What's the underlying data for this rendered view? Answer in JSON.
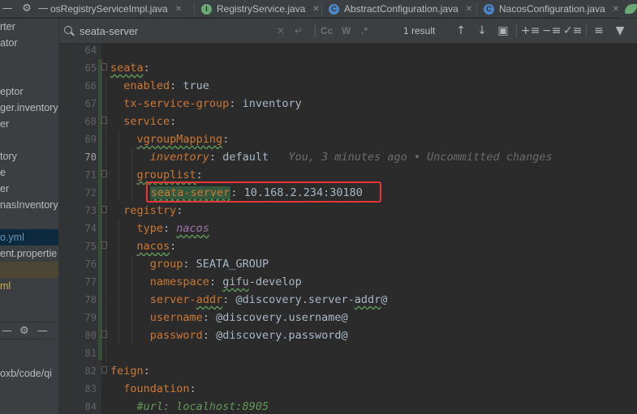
{
  "tabs": [
    {
      "label": "osRegistryServiceImpl.java",
      "icon_letter": "",
      "icon_color": "#c07a34"
    },
    {
      "label": "RegistryService.java",
      "icon_letter": "I",
      "icon_color": "#6aab73"
    },
    {
      "label": "AbstractConfiguration.java",
      "icon_letter": "C",
      "icon_color": "#4a86c8"
    },
    {
      "label": "NacosConfiguration.java",
      "icon_letter": "C",
      "icon_color": "#4a86c8"
    }
  ],
  "project_tree": [
    {
      "label": "rter",
      "style": ""
    },
    {
      "label": "ator",
      "style": ""
    },
    {
      "label": "",
      "style": ""
    },
    {
      "label": "",
      "style": ""
    },
    {
      "label": "eptor",
      "style": ""
    },
    {
      "label": "ger.inventory",
      "style": ""
    },
    {
      "label": "er",
      "style": ""
    },
    {
      "label": "",
      "style": ""
    },
    {
      "label": "tory",
      "style": ""
    },
    {
      "label": "e",
      "style": ""
    },
    {
      "label": "er",
      "style": ""
    },
    {
      "label": "nasInventory",
      "style": ""
    },
    {
      "label": "",
      "style": ""
    },
    {
      "label": "o.yml",
      "style": "sel blue"
    },
    {
      "label": "ent.propertie",
      "style": ""
    },
    {
      "label": "",
      "style": "hl"
    },
    {
      "label": "ml",
      "style": "yellow"
    }
  ],
  "project_path": "oxb/code/qi",
  "search": {
    "query": "seata-server",
    "results": "1 result",
    "match_case_label": "Cc",
    "words_label": "W",
    "regex_label": ".*"
  },
  "editor": {
    "blame": "You, 3 minutes ago • Uncommitted changes",
    "lines": [
      {
        "num": "64",
        "parts": []
      },
      {
        "num": "65",
        "parts": [
          {
            "t": "seata",
            "c": "ks"
          },
          {
            "t": ":",
            "c": "v"
          }
        ]
      },
      {
        "num": "66",
        "parts": [
          {
            "t": "  "
          },
          {
            "t": "enabled",
            "c": "k"
          },
          {
            "t": ": true",
            "c": "v"
          }
        ]
      },
      {
        "num": "67",
        "parts": [
          {
            "t": "  "
          },
          {
            "t": "tx-service-group",
            "c": "k"
          },
          {
            "t": ": inventory",
            "c": "v"
          }
        ]
      },
      {
        "num": "68",
        "parts": [
          {
            "t": "  "
          },
          {
            "t": "service",
            "c": "k"
          },
          {
            "t": ":",
            "c": "v"
          }
        ]
      },
      {
        "num": "69",
        "parts": [
          {
            "t": "    "
          },
          {
            "t": "vgroupMapping",
            "c": "ks"
          },
          {
            "t": ":",
            "c": "v"
          }
        ]
      },
      {
        "num": "70",
        "cur": true,
        "parts": [
          {
            "t": "      "
          },
          {
            "t": "inventory",
            "c": "ki"
          },
          {
            "t": ": default",
            "c": "v"
          },
          {
            "t": "   "
          },
          {
            "t": "You, 3 minutes ago • Uncommitted changes",
            "c": "blame"
          }
        ]
      },
      {
        "num": "71",
        "parts": [
          {
            "t": "    "
          },
          {
            "t": "grouplist",
            "c": "ks"
          },
          {
            "t": ":",
            "c": "v"
          }
        ]
      },
      {
        "num": "72",
        "parts": [
          {
            "t": "      "
          },
          {
            "t": "seata-server",
            "c": "found"
          },
          {
            "t": ": 10.168.2.234:30180",
            "c": "v"
          }
        ]
      },
      {
        "num": "73",
        "parts": [
          {
            "t": "  "
          },
          {
            "t": "registry",
            "c": "k"
          },
          {
            "t": ":",
            "c": "v"
          }
        ]
      },
      {
        "num": "74",
        "parts": [
          {
            "t": "    "
          },
          {
            "t": "type",
            "c": "k"
          },
          {
            "t": ": ",
            "c": "v"
          },
          {
            "t": "nacos",
            "c": "vi"
          }
        ]
      },
      {
        "num": "75",
        "parts": [
          {
            "t": "    "
          },
          {
            "t": "nacos",
            "c": "ks"
          },
          {
            "t": ":",
            "c": "v"
          }
        ]
      },
      {
        "num": "76",
        "parts": [
          {
            "t": "      "
          },
          {
            "t": "group",
            "c": "k"
          },
          {
            "t": ": SEATA_GROUP",
            "c": "v"
          }
        ]
      },
      {
        "num": "77",
        "parts": [
          {
            "t": "      "
          },
          {
            "t": "namespace",
            "c": "k"
          },
          {
            "t": ": ",
            "c": "v"
          },
          {
            "t": "gifu",
            "c": "vs"
          },
          {
            "t": "-develop",
            "c": "v"
          }
        ]
      },
      {
        "num": "78",
        "parts": [
          {
            "t": "      "
          },
          {
            "t": "server-",
            "c": "k"
          },
          {
            "t": "addr",
            "c": "ks"
          },
          {
            "t": ": @discovery.server-",
            "c": "v"
          },
          {
            "t": "addr",
            "c": "vs"
          },
          {
            "t": "@",
            "c": "v"
          }
        ]
      },
      {
        "num": "79",
        "parts": [
          {
            "t": "      "
          },
          {
            "t": "username",
            "c": "k"
          },
          {
            "t": ": @discovery.username@",
            "c": "v"
          }
        ]
      },
      {
        "num": "80",
        "parts": [
          {
            "t": "      "
          },
          {
            "t": "password",
            "c": "k"
          },
          {
            "t": ": @discovery.password@",
            "c": "v"
          }
        ]
      },
      {
        "num": "81",
        "parts": []
      },
      {
        "num": "82",
        "parts": [
          {
            "t": "feign",
            "c": "k"
          },
          {
            "t": ":",
            "c": "v"
          }
        ]
      },
      {
        "num": "83",
        "parts": [
          {
            "t": "  "
          },
          {
            "t": "foundation",
            "c": "k"
          },
          {
            "t": ":",
            "c": "v"
          }
        ]
      },
      {
        "num": "84",
        "parts": [
          {
            "t": "    "
          },
          {
            "t": "#url: localhost:8905",
            "c": "cm"
          }
        ]
      }
    ]
  },
  "colors": {
    "background": "#2b2b2b",
    "keyword": "#cc7832",
    "search_match": "#32593d",
    "highlight_box": "#e83535"
  }
}
